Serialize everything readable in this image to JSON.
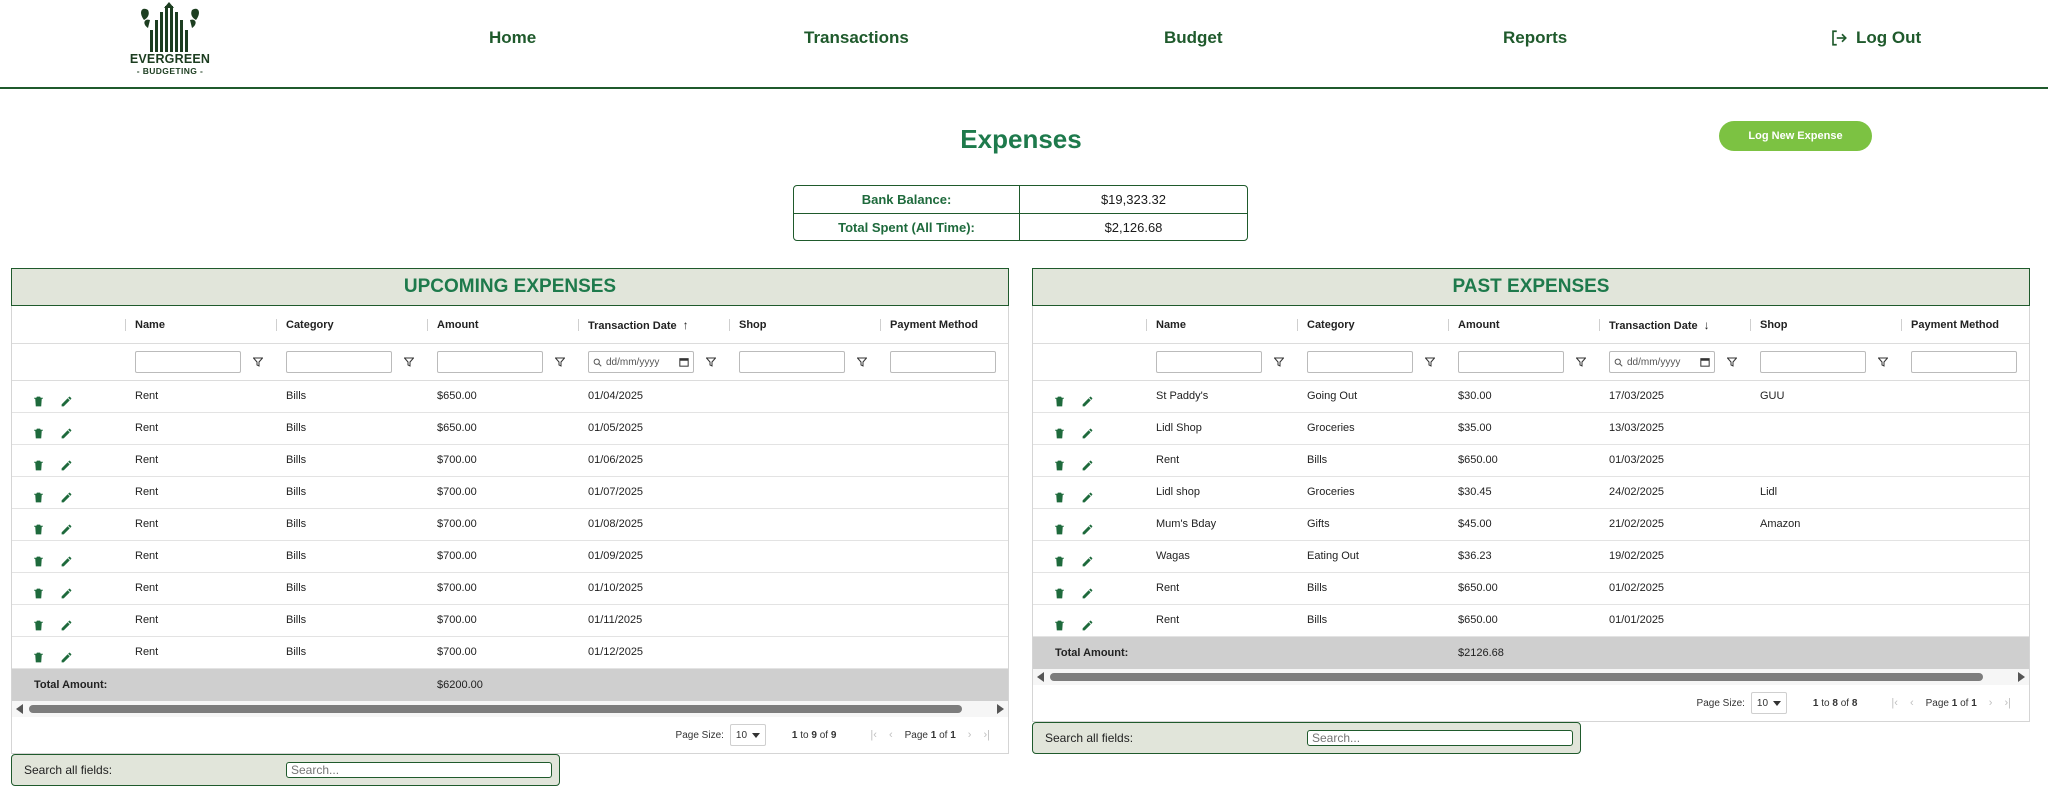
{
  "nav": {
    "logo_line1": "EVERGREEN",
    "logo_line2": "- BUDGETING -",
    "home": "Home",
    "transactions": "Transactions",
    "budget": "Budget",
    "reports": "Reports",
    "logout": "Log Out"
  },
  "page": {
    "title": "Expenses",
    "new_button": "Log New Expense"
  },
  "summary": {
    "bank_balance_label": "Bank Balance:",
    "bank_balance_value": "$19,323.32",
    "total_spent_label": "Total Spent (All Time):",
    "total_spent_value": "$2,126.68"
  },
  "columns": [
    "Name",
    "Category",
    "Amount",
    "Transaction Date",
    "Shop",
    "Payment Method"
  ],
  "date_placeholder": "dd/mm/yyyy",
  "upcoming": {
    "title": "UPCOMING EXPENSES",
    "sort": "asc",
    "rows": [
      {
        "name": "Rent",
        "category": "Bills",
        "amount": "$650.00",
        "date": "01/04/2025",
        "shop": "",
        "payment": ""
      },
      {
        "name": "Rent",
        "category": "Bills",
        "amount": "$650.00",
        "date": "01/05/2025",
        "shop": "",
        "payment": ""
      },
      {
        "name": "Rent",
        "category": "Bills",
        "amount": "$700.00",
        "date": "01/06/2025",
        "shop": "",
        "payment": ""
      },
      {
        "name": "Rent",
        "category": "Bills",
        "amount": "$700.00",
        "date": "01/07/2025",
        "shop": "",
        "payment": ""
      },
      {
        "name": "Rent",
        "category": "Bills",
        "amount": "$700.00",
        "date": "01/08/2025",
        "shop": "",
        "payment": ""
      },
      {
        "name": "Rent",
        "category": "Bills",
        "amount": "$700.00",
        "date": "01/09/2025",
        "shop": "",
        "payment": ""
      },
      {
        "name": "Rent",
        "category": "Bills",
        "amount": "$700.00",
        "date": "01/10/2025",
        "shop": "",
        "payment": ""
      },
      {
        "name": "Rent",
        "category": "Bills",
        "amount": "$700.00",
        "date": "01/11/2025",
        "shop": "",
        "payment": ""
      },
      {
        "name": "Rent",
        "category": "Bills",
        "amount": "$700.00",
        "date": "01/12/2025",
        "shop": "",
        "payment": ""
      }
    ],
    "total_label": "Total Amount:",
    "total_value": "$6200.00",
    "page_size_label": "Page Size:",
    "page_size": "10",
    "range_from": "1",
    "range_to": "9",
    "range_total": "9",
    "page_current": "1",
    "page_total": "1",
    "search_label": "Search all fields:",
    "search_placeholder": "Search..."
  },
  "past": {
    "title": "PAST EXPENSES",
    "sort": "desc",
    "rows": [
      {
        "name": "St Paddy's",
        "category": "Going Out",
        "amount": "$30.00",
        "date": "17/03/2025",
        "shop": "GUU",
        "payment": ""
      },
      {
        "name": "Lidl Shop",
        "category": "Groceries",
        "amount": "$35.00",
        "date": "13/03/2025",
        "shop": "",
        "payment": ""
      },
      {
        "name": "Rent",
        "category": "Bills",
        "amount": "$650.00",
        "date": "01/03/2025",
        "shop": "",
        "payment": ""
      },
      {
        "name": "Lidl shop",
        "category": "Groceries",
        "amount": "$30.45",
        "date": "24/02/2025",
        "shop": "Lidl",
        "payment": ""
      },
      {
        "name": "Mum's Bday",
        "category": "Gifts",
        "amount": "$45.00",
        "date": "21/02/2025",
        "shop": "Amazon",
        "payment": ""
      },
      {
        "name": "Wagas",
        "category": "Eating Out",
        "amount": "$36.23",
        "date": "19/02/2025",
        "shop": "",
        "payment": ""
      },
      {
        "name": "Rent",
        "category": "Bills",
        "amount": "$650.00",
        "date": "01/02/2025",
        "shop": "",
        "payment": ""
      },
      {
        "name": "Rent",
        "category": "Bills",
        "amount": "$650.00",
        "date": "01/01/2025",
        "shop": "",
        "payment": ""
      }
    ],
    "total_label": "Total Amount:",
    "total_value": "$2126.68",
    "page_size_label": "Page Size:",
    "page_size": "10",
    "range_from": "1",
    "range_to": "8",
    "range_total": "8",
    "page_current": "1",
    "page_total": "1",
    "search_label": "Search all fields:",
    "search_placeholder": "Search..."
  },
  "colors": {
    "brand_green": "#1e7a4c",
    "dark_green": "#1f5a2c",
    "button_green": "#7cc242",
    "panel_bg": "#e1e5da"
  }
}
